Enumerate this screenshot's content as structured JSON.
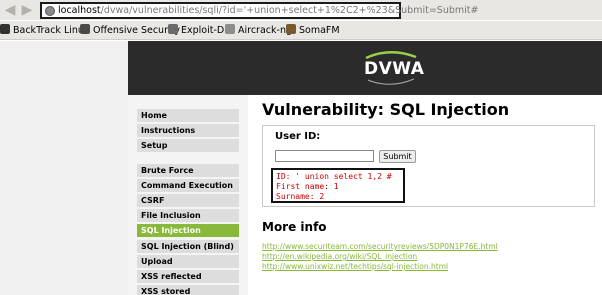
{
  "browser": {
    "url_host": "localhost",
    "url_rest": "/dvwa/vulnerabilities/sqli/?id='+union+select+1%2C2+%23&Submit=Submit#",
    "bookmarks": [
      "BackTrack Linux",
      "Offensive Security",
      "Exploit-DB",
      "Aircrack-ng",
      "SomaFM"
    ]
  },
  "header": {
    "logo_text": "DVWA"
  },
  "menu": {
    "group1": [
      "Home",
      "Instructions",
      "Setup"
    ],
    "group2": [
      "Brute Force",
      "Command Execution",
      "CSRF",
      "File Inclusion",
      "SQL Injection",
      "SQL Injection (Blind)",
      "Upload",
      "XSS reflected",
      "XSS stored"
    ],
    "active": "SQL Injection"
  },
  "main": {
    "title": "Vulnerability: SQL Injection",
    "form": {
      "userid_label": "User ID:",
      "input_value": "",
      "submit_label": "Submit"
    },
    "result": {
      "line1": "ID: ' union select 1,2 #",
      "line2": "First name: 1",
      "line3": "Surname: 2"
    },
    "more_info_title": "More info",
    "links": [
      "http://www.securiteam.com/securityreviews/5DP0N1P76E.html",
      "http://en.wikipedia.org/wiki/SQL_injection",
      "http://www.unixwiz.net/techtips/sql-injection.html"
    ]
  },
  "colors": {
    "accent": "#88b93a",
    "header_bg": "#2b2b2b",
    "result_text": "#d00000"
  }
}
